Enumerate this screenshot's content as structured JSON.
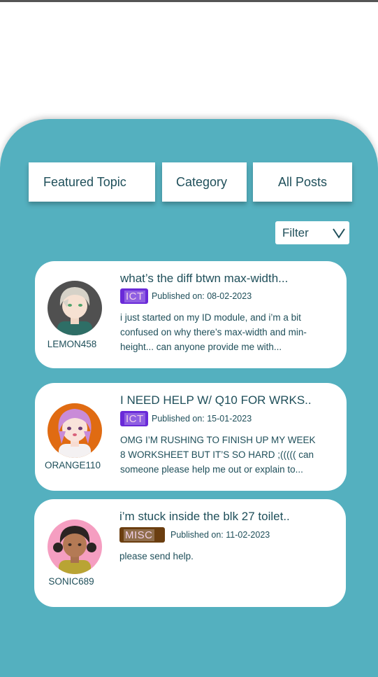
{
  "tabs": {
    "featured": "Featured Topic",
    "category": "Category",
    "all_posts": "All Posts"
  },
  "filter": {
    "label": "Filter",
    "icon": "chevron-down-icon"
  },
  "posts": [
    {
      "username": "LEMON458",
      "title": "what’s the diff btwn max-width...",
      "tag": "ICT",
      "published": "Published on: 08-02-2023",
      "excerpt": "i just started on my ID module, and i’m a bit confused on why there’s max-width and min-height... can anyone provide me with..."
    },
    {
      "username": "ORANGE110",
      "title": "I NEED HELP W/ Q10 FOR WRKS..",
      "tag": "ICT",
      "published": "Published on: 15-01-2023",
      "excerpt": "OMG I’M RUSHING TO FINISH UP MY WEEK 8 WORKSHEET BUT IT’S SO HARD ;((((( can someone please help me out or explain to..."
    },
    {
      "username": "SONIC689",
      "title": "i’m stuck inside the blk 27 toilet..",
      "tag": "MISC",
      "published": "Published on: 11-02-2023",
      "excerpt": "please send help."
    }
  ],
  "colors": {
    "panel": "#54b0bf",
    "text": "#1f4f5a",
    "tag_ict": "#6a2ad8",
    "tag_misc": "#6b3e10"
  }
}
